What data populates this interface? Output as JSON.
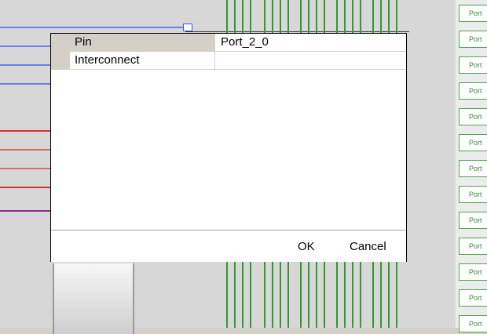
{
  "dialog": {
    "properties": [
      {
        "name": "Pin",
        "value": "Port_2_0"
      },
      {
        "name": "Interconnect",
        "value": ""
      }
    ],
    "ok_label": "OK",
    "cancel_label": "Cancel"
  },
  "background": {
    "port_label": "Port",
    "wire_colors": {
      "blue": "#5a6fe0",
      "red": "#d83030",
      "purple": "#8a2a8a",
      "green": "#2f9a2f"
    }
  }
}
